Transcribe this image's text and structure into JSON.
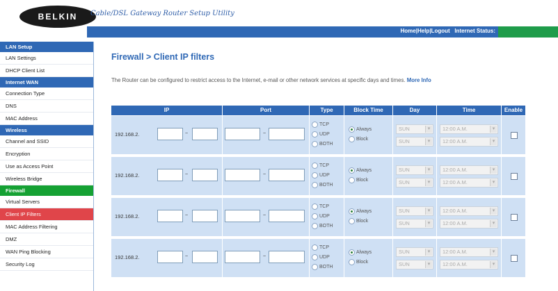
{
  "header": {
    "logo_text": "BELKIN",
    "utility_title": "Cable/DSL Gateway Router Setup Utility",
    "links": "Home|Help|Logout",
    "internet_status_label": "Internet Status:",
    "status_color": "#1f9c4a"
  },
  "sidebar": {
    "sections": [
      {
        "title": "LAN Setup",
        "items": [
          "LAN Settings",
          "DHCP Client List"
        ]
      },
      {
        "title": "Internet WAN",
        "items": [
          "Connection Type",
          "DNS",
          "MAC Address"
        ]
      },
      {
        "title": "Wireless",
        "items": [
          "Channel and SSID",
          "Encryption",
          "Use as Access Point",
          "Wireless Bridge"
        ]
      },
      {
        "title": "Firewall",
        "items": [
          "Virtual Servers",
          "Client IP Filters",
          "MAC Address Filtering",
          "DMZ",
          "WAN Ping Blocking",
          "Security Log"
        ]
      }
    ],
    "active_section": "Firewall",
    "active_item": "Client IP Filters"
  },
  "main": {
    "title": "Firewall > Client IP filters",
    "intro": "The Router can be configured to restrict access to the Internet, e-mail or other network services at specific days and times.",
    "more_info": "More Info"
  },
  "table": {
    "headers": [
      "IP",
      "Port",
      "Type",
      "Block Time",
      "Day",
      "Time",
      "Enable"
    ],
    "ip_prefix": "192.168.2.",
    "type_options": [
      "TCP",
      "UDP",
      "BOTH"
    ],
    "block_options": [
      "Always",
      "Block"
    ],
    "day_values": [
      "SUN",
      "SUN"
    ],
    "time_values": [
      "12:00 A.M.",
      "12:00 A.M."
    ],
    "rows": [
      {
        "block_selected": "Always",
        "enabled": false
      },
      {
        "block_selected": "Always",
        "enabled": false
      },
      {
        "block_selected": "Always",
        "enabled": false
      },
      {
        "block_selected": "Always",
        "enabled": false
      }
    ]
  }
}
